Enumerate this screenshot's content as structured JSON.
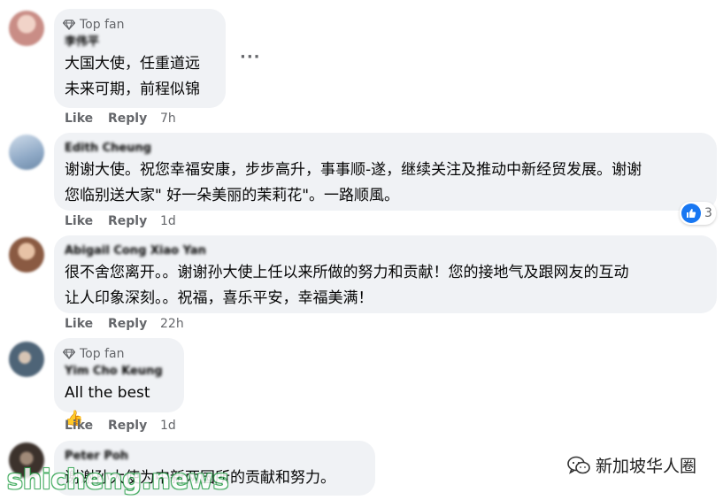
{
  "comments": [
    {
      "badge": "Top fan",
      "name": "李伟平",
      "lines": "大国大使，任重道远\n未来可期，前程似锦",
      "like": "Like",
      "reply": "Reply",
      "time": "7h",
      "more": "···",
      "avatar_color": "#c98d86"
    },
    {
      "badge": "",
      "name": "Edith Cheung",
      "lines": "谢谢大使。祝您幸福安康，步步高升，事事顺-遂，继续关注及推动中新经贸发展。谢谢\n您临别送大家\" 好一朵美丽的茉莉花\"。一路顺風。",
      "like": "Like",
      "reply": "Reply",
      "time": "1d",
      "reaction_count": "3",
      "avatar_color": "#9ab4cf"
    },
    {
      "badge": "",
      "name": "Abigail Cong Xiao Yan",
      "lines": "很不舍您离开。。谢谢孙大使上任以来所做的努力和贡献！您的接地气及跟网友的互动\n让人印象深刻。。祝福，喜乐平安，幸福美满！",
      "like": "Like",
      "reply": "Reply",
      "time": "22h",
      "avatar_color": "#b07b62"
    },
    {
      "badge": "Top fan",
      "name": "Yim Cho Keung",
      "lines": "All the best 👍",
      "like": "Like",
      "reply": "Reply",
      "time": "1d",
      "avatar_color": "#6b8296"
    },
    {
      "badge": "",
      "name": "Peter Poh",
      "lines": "谢谢孙大使为中新两国所的贡献和努力。",
      "avatar_color": "#5c4f48"
    }
  ],
  "watermark": {
    "left": "shicheng.news",
    "right": "新加坡华人圈"
  },
  "colors": {
    "bubble": "#f0f2f5",
    "meta": "#65676b",
    "like_blue": "#1877f2",
    "watermark_green": "#2aa14a"
  }
}
